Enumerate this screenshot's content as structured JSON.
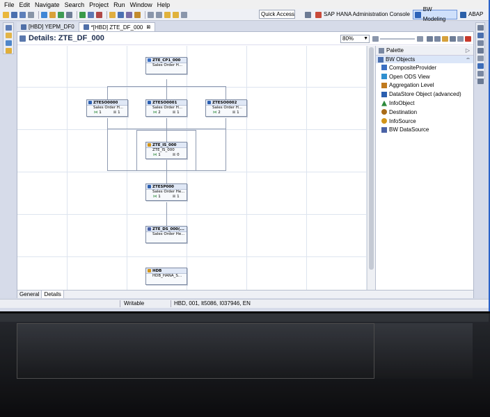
{
  "menu": [
    "File",
    "Edit",
    "Navigate",
    "Search",
    "Project",
    "Run",
    "Window",
    "Help"
  ],
  "toolbar": {
    "quick_access": "Quick Access"
  },
  "perspectives": [
    {
      "label": "SAP HANA Administration Console"
    },
    {
      "label": "BW Modeling",
      "active": true
    },
    {
      "label": "ABAP"
    }
  ],
  "tabs": [
    {
      "label": "[HBD] YEPM_DF0",
      "active": false
    },
    {
      "label": "*[HBD] ZTE_DF_000",
      "active": true,
      "close": "⊠"
    }
  ],
  "editor": {
    "title": "Details:  ZTE_DF_000",
    "zoom": "80%",
    "zoom_arrow": "▼"
  },
  "nodes": {
    "cp": {
      "title": "ZTE_CP1_000",
      "sub": "Sales Order H..."
    },
    "ds0": {
      "title": "ZTESO0000",
      "sub": "Sales Order H...",
      "left": "1",
      "right": "1"
    },
    "ds1": {
      "title": "ZTESO0001",
      "sub": "Sales Order H...",
      "left": "2",
      "right": "1"
    },
    "ds2": {
      "title": "ZTESO0002",
      "sub": "Sales Order H...",
      "left": "2",
      "right": "1"
    },
    "is": {
      "title": "ZTE_IS_000",
      "sub": "ZTE_IS_000",
      "left": "1",
      "right": "0"
    },
    "sp": {
      "title": "ZTESP000",
      "sub": "Sales Order He...",
      "left": "1",
      "right": "1"
    },
    "bds": {
      "title": "ZTE_DS_000(...",
      "sub": "Sales Order He..."
    },
    "hdb": {
      "title": "HDB",
      "sub": "HDB_HANA_S..."
    }
  },
  "palette": {
    "title": "Palette",
    "collapse": "▷",
    "drawer": "BW Objects",
    "pin": "⇔",
    "items": [
      {
        "label": "CompositeProvider",
        "color": "#3b6fc2"
      },
      {
        "label": "Open ODS View",
        "color": "#2f8fcf"
      },
      {
        "label": "Aggregation Level",
        "color": "#c07a1e"
      },
      {
        "label": "DataStore Object (advanced)",
        "color": "#2b5fb0"
      },
      {
        "label": "InfoObject",
        "color": "#2d8a3b"
      },
      {
        "label": "Destination",
        "color": "#a96b17"
      },
      {
        "label": "InfoSource",
        "color": "#d29418"
      },
      {
        "label": "BW DataSource",
        "color": "#4a62a6"
      }
    ]
  },
  "bottom_tabs": [
    "General",
    "Details"
  ],
  "status": {
    "writable": "Writable",
    "info": "HBD, 001, lt5086, I037946, EN"
  }
}
